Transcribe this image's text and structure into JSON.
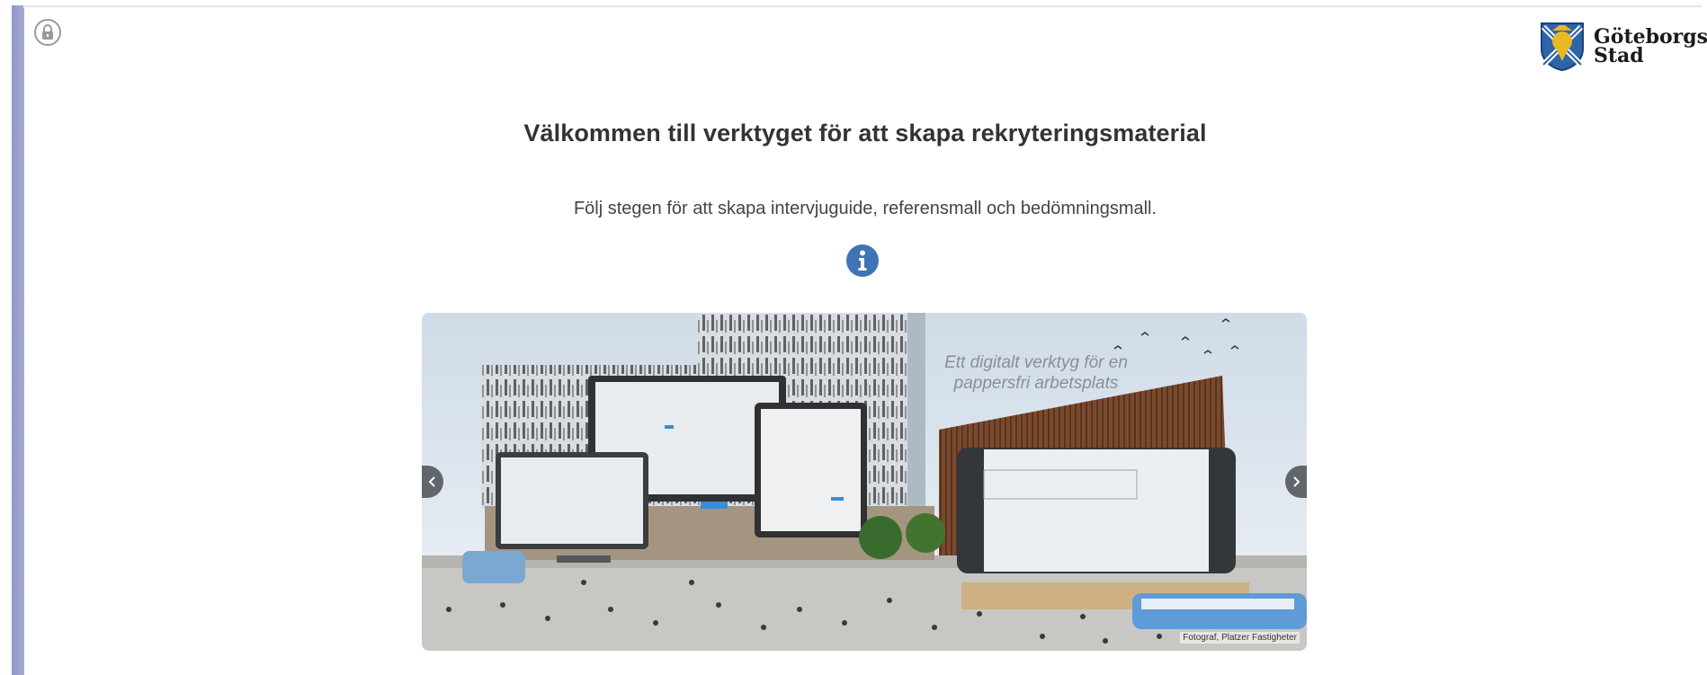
{
  "header": {
    "logo_text_line1": "Göteborgs",
    "logo_text_line2": "Stad",
    "lock_icon": "lock-icon"
  },
  "main": {
    "title": "Välkommen till verktyget för att skapa rekryteringsmaterial",
    "subtitle": "Följ stegen för att skapa intervjuguide, referensmall och bedömningsmall.",
    "info_icon": "info-icon"
  },
  "carousel": {
    "caption": "Ett digitalt verktyg för en pappersfri arbetsplats",
    "credit": "Fotograf, Platzer Fastigheter",
    "prev_icon": "chevron-left-icon",
    "next_icon": "chevron-right-icon"
  },
  "colors": {
    "accent_blue": "#3f74b6",
    "left_rail": "#a6abd6",
    "text_primary": "#333333"
  }
}
